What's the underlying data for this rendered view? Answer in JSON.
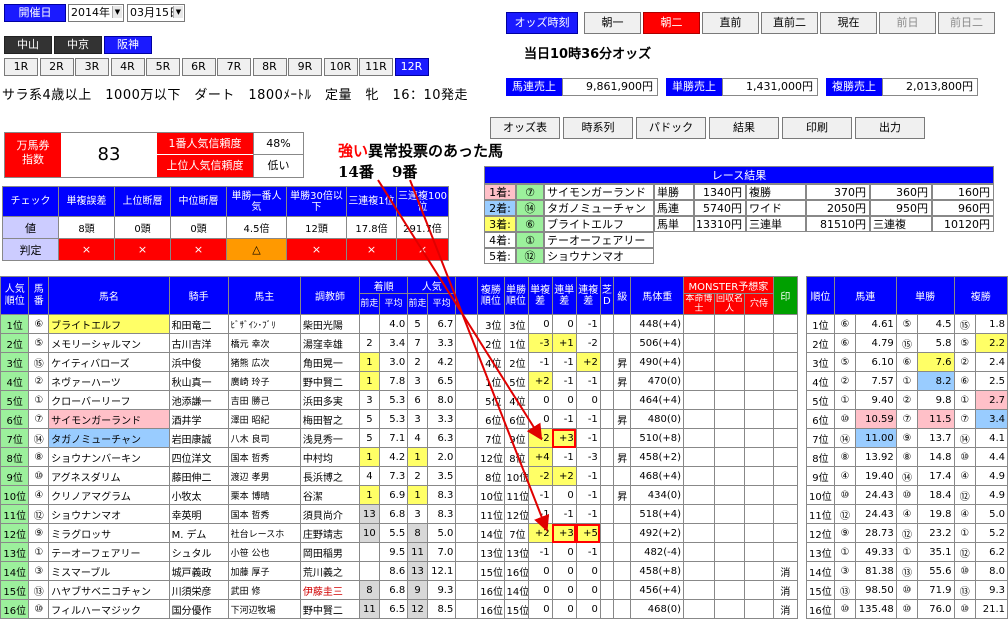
{
  "header": {
    "date_label": "開催日",
    "year": "2014年",
    "day": "03月15日",
    "venues": [
      "中山",
      "中京",
      "阪神"
    ],
    "selected_venue": 2,
    "races": [
      "1R",
      "2R",
      "3R",
      "4R",
      "5R",
      "6R",
      "7R",
      "8R",
      "9R",
      "10R",
      "11R",
      "12R"
    ],
    "selected_race": 11,
    "race_info": "サラ系4歳以上　1000万以下　ダート　1800ﾒｰﾄﾙ　定量　牝　16：10発走"
  },
  "odds_time": {
    "label": "オッズ時刻",
    "buttons": [
      "朝一",
      "朝二",
      "直前",
      "直前二",
      "現在",
      "前日",
      "前日二"
    ],
    "selected": 1,
    "current": "当日10時36分オッズ"
  },
  "sales": [
    {
      "label": "馬連売上",
      "value": "9,861,900円"
    },
    {
      "label": "単勝売上",
      "value": "1,431,000円"
    },
    {
      "label": "複勝売上",
      "value": "2,013,800円"
    }
  ],
  "actions": [
    "オッズ表",
    "時系列",
    "パドック",
    "結果",
    "印刷",
    "出力"
  ],
  "index": {
    "label": "万馬券\n指数",
    "value": "83",
    "pop1_label": "1番人気信頼度",
    "pop1_value": "48%",
    "top_label": "上位人気信頼度",
    "top_value": "低い"
  },
  "annotation": {
    "strong": "強い",
    "rest": "異常投票のあった馬",
    "h1": "14番",
    "h2": "9番"
  },
  "check": {
    "headers": [
      "チェック",
      "単複誤差",
      "上位断層",
      "中位断層",
      "単勝一番人気",
      "単勝30倍以下",
      "三連複1位",
      "三連複100位"
    ],
    "values_label": "値",
    "values": [
      "8頭",
      "0頭",
      "0頭",
      "4.5倍",
      "12頭",
      "17.8倍",
      "291.7倍"
    ],
    "judge_label": "判定",
    "judges": [
      "×",
      "×",
      "×",
      "△",
      "×",
      "×",
      "×"
    ]
  },
  "result": {
    "title": "レース結果",
    "places": [
      {
        "rank": "1着:",
        "num": "⑦",
        "name": "サイモンガーランド",
        "bg": "#ffc0c8"
      },
      {
        "rank": "2着:",
        "num": "⑭",
        "name": "タガノミューチャン",
        "bg": "#99ccff"
      },
      {
        "rank": "3着:",
        "num": "⑥",
        "name": "ブライトエルフ",
        "bg": "#ffff66"
      },
      {
        "rank": "4着:",
        "num": "①",
        "name": "テーオーフェアリー",
        "bg": "#ffffff"
      },
      {
        "rank": "5着:",
        "num": "⑫",
        "name": "ショウナンマオ",
        "bg": "#ffffff"
      }
    ],
    "payouts": [
      [
        "単勝",
        "1340円",
        "複勝",
        "370円",
        "360円",
        "160円"
      ],
      [
        "馬連",
        "5740円",
        "ワイド",
        "2050円",
        "950円",
        "960円"
      ],
      [
        "馬単",
        "13310円",
        "三連単",
        "81510円",
        "三連複",
        "10120円"
      ]
    ]
  },
  "main_headers": {
    "rank": "人気順位",
    "num": "馬番",
    "name": "馬名",
    "jockey": "騎手",
    "owner": "馬主",
    "trainer": "調教師",
    "chaku": "着順",
    "ninki": "人気",
    "zen": "前走",
    "hei": "平均",
    "fuku": "複勝順位",
    "tan": "単勝順位",
    "d1": "単複差",
    "d2": "連単差",
    "d3": "連複差",
    "koma": "芝D",
    "kyu": "級",
    "weight": "馬体重",
    "monster": "MONSTER予想家",
    "m1": "本命博士",
    "m2": "回収名人",
    "m3": "穴侍",
    "mark": "印"
  },
  "rows": [
    {
      "rank": "1位",
      "num": "⑥",
      "name": "ブライトエルフ",
      "nbg": "#ffff66",
      "jockey": "和田竜二",
      "owner": "ﾋﾞｻﾞｲﾝ･ﾌﾞﾘ",
      "trainer": "柴田光陽",
      "c1": "",
      "c2": "4.0",
      "n1": "5",
      "n2": "6.7",
      "fk": "3位",
      "tn": "3位",
      "d1": "0",
      "d2": "0",
      "d3": "-1",
      "kyu": "",
      "wt": "448(+4)"
    },
    {
      "rank": "2位",
      "num": "⑤",
      "name": "メモリーシャルマン",
      "nbg": "#fff",
      "jockey": "古川吉洋",
      "owner": "橋元 幸次",
      "trainer": "湯窪幸雄",
      "c1": "2",
      "c2": "3.4",
      "n1": "7",
      "n2": "3.3",
      "fk": "2位",
      "tn": "1位",
      "d1": "-3",
      "d2": "+1",
      "d3": "-2",
      "kyu": "",
      "wt": "506(+4)"
    },
    {
      "rank": "3位",
      "num": "⑮",
      "name": "ケイティバローズ",
      "nbg": "#fff",
      "jockey": "浜中俊",
      "owner": "猪熊 広次",
      "trainer": "角田晃一",
      "c1": "1",
      "c2": "3.0",
      "n1": "2",
      "n2": "4.2",
      "fk": "4位",
      "tn": "2位",
      "d1": "-1",
      "d2": "-1",
      "d3": "+2",
      "kyu": "昇",
      "wt": "490(+4)"
    },
    {
      "rank": "4位",
      "num": "②",
      "name": "ネヴァーハーツ",
      "nbg": "#fff",
      "jockey": "秋山真一",
      "owner": "廣崎 玲子",
      "trainer": "野中賢二",
      "c1": "1",
      "c2": "7.8",
      "n1": "3",
      "n2": "6.5",
      "fk": "1位",
      "tn": "5位",
      "d1": "+2",
      "d2": "-1",
      "d3": "-1",
      "kyu": "昇",
      "wt": "470(0)"
    },
    {
      "rank": "5位",
      "num": "①",
      "name": "クローバーリーフ",
      "nbg": "#fff",
      "jockey": "池添謙一",
      "owner": "吉田 勝己",
      "trainer": "浜田多実",
      "c1": "3",
      "c2": "5.3",
      "n1": "6",
      "n2": "8.0",
      "fk": "5位",
      "tn": "4位",
      "d1": "0",
      "d2": "0",
      "d3": "0",
      "kyu": "",
      "wt": "464(+4)"
    },
    {
      "rank": "6位",
      "num": "⑦",
      "name": "サイモンガーランド",
      "nbg": "#ffc0c8",
      "jockey": "酒井学",
      "owner": "澤田 昭紀",
      "trainer": "梅田智之",
      "c1": "5",
      "c2": "5.3",
      "n1": "3",
      "n2": "3.3",
      "fk": "6位",
      "tn": "6位",
      "d1": "0",
      "d2": "-1",
      "d3": "-1",
      "kyu": "昇",
      "wt": "480(0)"
    },
    {
      "rank": "7位",
      "num": "⑭",
      "name": "タガノミューチャン",
      "nbg": "#99ccff",
      "jockey": "岩田康誠",
      "owner": "八木 良司",
      "trainer": "浅見秀一",
      "c1": "5",
      "c2": "7.1",
      "n1": "4",
      "n2": "6.3",
      "fk": "7位",
      "tn": "9位",
      "d1": "-2",
      "d2": "+3",
      "d3": "-1",
      "kyu": "",
      "wt": "510(+8)"
    },
    {
      "rank": "8位",
      "num": "⑧",
      "name": "ショウナンバーキン",
      "nbg": "#fff",
      "jockey": "四位洋文",
      "owner": "国本 哲秀",
      "trainer": "中村均",
      "c1": "1",
      "c2": "4.2",
      "n1": "1",
      "n2": "2.0",
      "fk": "12位",
      "tn": "8位",
      "d1": "+4",
      "d2": "-1",
      "d3": "-3",
      "kyu": "昇",
      "wt": "458(+2)"
    },
    {
      "rank": "9位",
      "num": "⑩",
      "name": "アグネスダリム",
      "nbg": "#fff",
      "jockey": "藤田伸二",
      "owner": "渡辺 孝男",
      "trainer": "長浜博之",
      "c1": "4",
      "c2": "7.3",
      "n1": "2",
      "n2": "3.5",
      "fk": "8位",
      "tn": "10位",
      "d1": "-2",
      "d2": "+2",
      "d3": "-1",
      "kyu": "",
      "wt": "468(+4)"
    },
    {
      "rank": "10位",
      "num": "④",
      "name": "クリノアマグラム",
      "nbg": "#fff",
      "jockey": "小牧太",
      "owner": "栗本 博晴",
      "trainer": "谷潔",
      "c1": "1",
      "c2": "6.9",
      "n1": "1",
      "n2": "8.3",
      "fk": "10位",
      "tn": "11位",
      "d1": "-1",
      "d2": "0",
      "d3": "-1",
      "kyu": "昇",
      "wt": "434(0)"
    },
    {
      "rank": "11位",
      "num": "⑫",
      "name": "ショウナンマオ",
      "nbg": "#fff",
      "jockey": "幸英明",
      "owner": "国本 哲秀",
      "trainer": "須貝尚介",
      "c1": "13",
      "c2": "6.8",
      "n1": "3",
      "n2": "8.3",
      "fk": "11位",
      "tn": "12位",
      "d1": "-1",
      "d2": "-1",
      "d3": "-1",
      "kyu": "",
      "wt": "518(+4)"
    },
    {
      "rank": "12位",
      "num": "⑨",
      "name": "ミラグロッサ",
      "nbg": "#fff",
      "jockey": "M. デム",
      "owner": "社台レースホ",
      "trainer": "庄野靖志",
      "c1": "10",
      "c2": "5.5",
      "n1": "8",
      "n2": "5.0",
      "fk": "14位",
      "tn": "7位",
      "d1": "+2",
      "d2": "+3",
      "d3": "+5",
      "kyu": "",
      "wt": "492(+2)"
    },
    {
      "rank": "13位",
      "num": "①",
      "name": "テーオーフェアリー",
      "nbg": "#fff",
      "jockey": "シュタル",
      "owner": "小笹 公也",
      "trainer": "岡田稲男",
      "c1": "",
      "c2": "9.5",
      "n1": "11",
      "n2": "7.0",
      "fk": "13位",
      "tn": "13位",
      "d1": "-1",
      "d2": "0",
      "d3": "-1",
      "kyu": "",
      "wt": "482(-4)"
    },
    {
      "rank": "14位",
      "num": "③",
      "name": "ミスマーブル",
      "nbg": "#fff",
      "jockey": "城戸義政",
      "owner": "加藤 厚子",
      "trainer": "荒川義之",
      "c1": "",
      "c2": "8.6",
      "n1": "13",
      "n2": "12.1",
      "fk": "15位",
      "tn": "16位",
      "d1": "0",
      "d2": "0",
      "d3": "0",
      "kyu": "",
      "wt": "458(+8)"
    },
    {
      "rank": "15位",
      "num": "⑬",
      "name": "ハヤブサベニコチャン",
      "nbg": "#fff",
      "jockey": "川須栄彦",
      "owner": "武田 修",
      "trainer": "伊藤圭三",
      "c1": "8",
      "c2": "6.8",
      "n1": "9",
      "n2": "9.3",
      "fk": "16位",
      "tn": "14位",
      "d1": "0",
      "d2": "0",
      "d3": "0",
      "kyu": "",
      "wt": "456(+4)"
    },
    {
      "rank": "16位",
      "num": "⑩",
      "name": "フィルハーマジック",
      "nbg": "#fff",
      "jockey": "国分優作",
      "owner": "下河辺牧場",
      "trainer": "野中賢二",
      "c1": "11",
      "c2": "6.5",
      "n1": "12",
      "n2": "8.5",
      "fk": "16位",
      "tn": "15位",
      "d1": "0",
      "d2": "0",
      "d3": "0",
      "kyu": "",
      "wt": "468(0)"
    }
  ],
  "side_headers": [
    "順位",
    "馬連",
    "単勝",
    "複勝"
  ],
  "side_rows": [
    {
      "r": "1位",
      "a": "⑥",
      "av": "4.61",
      "b": "⑤",
      "bv": "4.5",
      "c": "⑮",
      "cv": "1.8"
    },
    {
      "r": "2位",
      "a": "⑥",
      "av": "4.79",
      "b": "⑮",
      "bv": "5.8",
      "c": "⑤",
      "cv": "2.2"
    },
    {
      "r": "3位",
      "a": "⑤",
      "av": "6.10",
      "b": "⑥",
      "bv": "7.6",
      "c": "②",
      "cv": "2.4"
    },
    {
      "r": "4位",
      "a": "②",
      "av": "7.57",
      "b": "①",
      "bv": "8.2",
      "c": "⑥",
      "cv": "2.5"
    },
    {
      "r": "5位",
      "a": "①",
      "av": "9.40",
      "b": "②",
      "bv": "9.8",
      "c": "①",
      "cv": "2.7"
    },
    {
      "r": "6位",
      "a": "⑩",
      "av": "10.59",
      "b": "⑦",
      "bv": "11.5",
      "c": "⑦",
      "cv": "3.4"
    },
    {
      "r": "7位",
      "a": "⑭",
      "av": "11.00",
      "b": "⑨",
      "bv": "13.7",
      "c": "⑭",
      "cv": "4.1"
    },
    {
      "r": "8位",
      "a": "⑧",
      "av": "13.92",
      "b": "⑧",
      "bv": "14.8",
      "c": "⑩",
      "cv": "4.4"
    },
    {
      "r": "9位",
      "a": "④",
      "av": "19.40",
      "b": "⑭",
      "bv": "17.4",
      "c": "④",
      "cv": "4.9"
    },
    {
      "r": "10位",
      "a": "⑩",
      "av": "24.43",
      "b": "⑩",
      "bv": "18.4",
      "c": "⑫",
      "cv": "4.9"
    },
    {
      "r": "11位",
      "a": "⑫",
      "av": "24.43",
      "b": "④",
      "bv": "19.8",
      "c": "④",
      "cv": "5.0"
    },
    {
      "r": "12位",
      "a": "⑨",
      "av": "28.73",
      "b": "⑫",
      "bv": "23.2",
      "c": "①",
      "cv": "5.2"
    },
    {
      "r": "13位",
      "a": "①",
      "av": "49.33",
      "b": "①",
      "bv": "35.1",
      "c": "⑫",
      "cv": "6.2"
    },
    {
      "r": "14位",
      "a": "③",
      "av": "81.38",
      "b": "⑬",
      "bv": "55.6",
      "c": "⑩",
      "cv": "8.0"
    },
    {
      "r": "15位",
      "a": "⑬",
      "av": "98.50",
      "b": "⑩",
      "bv": "71.9",
      "c": "⑬",
      "cv": "9.3"
    },
    {
      "r": "16位",
      "a": "⑩",
      "av": "135.48",
      "b": "⑩",
      "bv": "76.0",
      "c": "⑩",
      "cv": "21.1"
    }
  ],
  "mark_values": [
    "",
    "",
    "",
    "",
    "",
    "",
    "",
    "",
    "",
    "",
    "",
    "",
    "",
    "消",
    "消",
    "消"
  ]
}
